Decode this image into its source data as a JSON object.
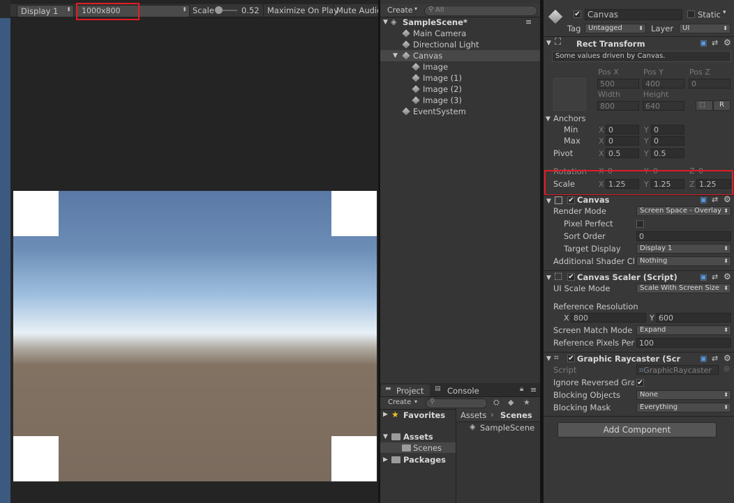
{
  "game": {
    "display": "Display 1",
    "resolution": "1000x800",
    "scale_label": "Scale",
    "scale_value": "0.52",
    "maximize": "Maximize On Play",
    "mute": "Mute Audio"
  },
  "hierarchy": {
    "create": "Create",
    "search_placeholder": "All",
    "scene": "SampleScene*",
    "items": [
      "Main Camera",
      "Directional Light",
      "Canvas",
      "Image",
      "Image (1)",
      "Image (2)",
      "Image (3)",
      "EventSystem"
    ]
  },
  "project": {
    "tab_project": "Project",
    "tab_console": "Console",
    "create": "Create",
    "favorites": "Favorites",
    "assets": "Assets",
    "scenes": "Scenes",
    "packages": "Packages",
    "breadcrumb_assets": "Assets",
    "breadcrumb_sep": "›",
    "breadcrumb_scenes": "Scenes",
    "file": "SampleScene"
  },
  "inspector": {
    "object_name": "Canvas",
    "static": "Static",
    "tag_label": "Tag",
    "tag_value": "Untagged",
    "layer_label": "Layer",
    "layer_value": "UI",
    "rect": {
      "title": "Rect Transform",
      "note": "Some values driven by Canvas.",
      "pos_x_label": "Pos X",
      "pos_y_label": "Pos Y",
      "pos_z_label": "Pos Z",
      "pos_x": "500",
      "pos_y": "400",
      "pos_z": "0",
      "width_label": "Width",
      "height_label": "Height",
      "width": "800",
      "height": "640",
      "r_button": "R",
      "anchors": "Anchors",
      "min": "Min",
      "max": "Max",
      "pivot": "Pivot",
      "min_x": "0",
      "min_y": "0",
      "max_x": "0",
      "max_y": "0",
      "pivot_x": "0.5",
      "pivot_y": "0.5",
      "rotation": "Rotation",
      "rot_x": "0",
      "rot_y": "0",
      "rot_z": "0",
      "scale": "Scale",
      "scale_x": "1.25",
      "scale_y": "1.25",
      "scale_z": "1.25",
      "axis_x": "X",
      "axis_y": "Y",
      "axis_z": "Z"
    },
    "canvas": {
      "title": "Canvas",
      "render_mode_label": "Render Mode",
      "render_mode": "Screen Space - Overlay",
      "pixel_perfect": "Pixel Perfect",
      "sort_order_label": "Sort Order",
      "sort_order": "0",
      "target_display_label": "Target Display",
      "target_display": "Display 1",
      "shader_label": "Additional Shader Ch",
      "shader_value": "Nothing"
    },
    "scaler": {
      "title": "Canvas Scaler (Script)",
      "ui_scale_label": "UI Scale Mode",
      "ui_scale": "Scale With Screen Size",
      "ref_res_label": "Reference Resolution",
      "ref_x": "800",
      "ref_y": "600",
      "match_label": "Screen Match Mode",
      "match": "Expand",
      "ppu_label": "Reference Pixels Per",
      "ppu": "100"
    },
    "raycaster": {
      "title": "Graphic Raycaster (Scr",
      "script_label": "Script",
      "script_value": "GraphicRaycaster",
      "ignore_label": "Ignore Reversed Gra",
      "blocking_objects_label": "Blocking Objects",
      "blocking_objects": "None",
      "blocking_mask_label": "Blocking Mask",
      "blocking_mask": "Everything"
    },
    "add_component": "Add Component"
  }
}
